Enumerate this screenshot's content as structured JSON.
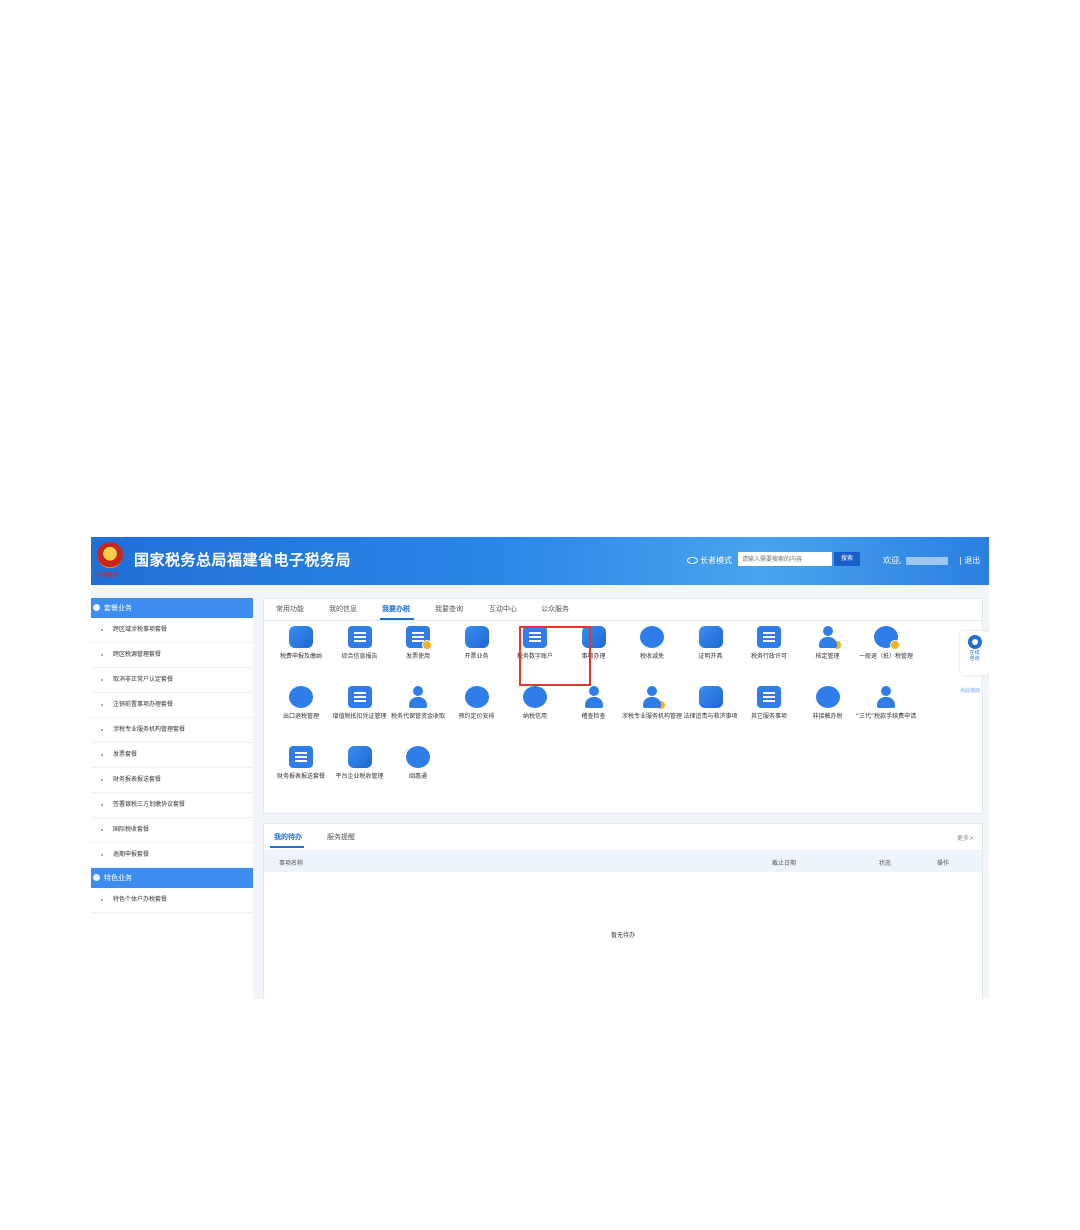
{
  "header": {
    "emblem_text": "中国税务",
    "title": "国家税务总局福建省电子税务局",
    "elder_mode": "长者模式",
    "search_placeholder": "请输入需要搜索的内容",
    "search_button": "搜索",
    "welcome": "欢迎,",
    "logout": "| 退出"
  },
  "sidebar": {
    "group1": "套餐业务",
    "items1": [
      "跨区域涉税事项套餐",
      "跨区税源管理套餐",
      "取消非正常户认定套餐",
      "注销前置事项办理套餐",
      "涉税专业服务机构管理套餐",
      "发票套餐",
      "财务报表报送套餐",
      "签署银税三方划缴协议套餐",
      "国际税收套餐",
      "逾期申报套餐"
    ],
    "group2": "特色业务",
    "items2": [
      "特色个体户办税套餐"
    ]
  },
  "tabs": [
    "常用功能",
    "我的信息",
    "我要办税",
    "我要查询",
    "互动中心",
    "公众服务"
  ],
  "services": [
    {
      "label": "税费申报及缴纳",
      "icon": "tax-declare-icon"
    },
    {
      "label": "综合信息报告",
      "icon": "report-doc-icon"
    },
    {
      "label": "发票使用",
      "icon": "invoice-icon"
    },
    {
      "label": "开票业务",
      "icon": "issue-invoice-icon"
    },
    {
      "label": "税务数字账户",
      "icon": "digital-account-icon"
    },
    {
      "label": "事项办理",
      "icon": "edit-matter-icon"
    },
    {
      "label": "税收减免",
      "icon": "tax-relief-icon"
    },
    {
      "label": "证明开具",
      "icon": "certificate-icon"
    },
    {
      "label": "税务行政许可",
      "icon": "license-icon"
    },
    {
      "label": "核定管理",
      "icon": "assessment-icon"
    },
    {
      "label": "一般退（抵）税管理",
      "icon": "refund-icon"
    },
    {
      "label": "出口退税管理",
      "icon": "export-refund-icon"
    },
    {
      "label": "增值税抵扣凭证管理",
      "icon": "vat-voucher-icon"
    },
    {
      "label": "税务代保管资金收取",
      "icon": "custody-funds-icon"
    },
    {
      "label": "预约定价安排",
      "icon": "pricing-icon"
    },
    {
      "label": "纳税信用",
      "icon": "credit-icon"
    },
    {
      "label": "稽查检查",
      "icon": "inspection-icon"
    },
    {
      "label": "涉税专业服务机构管理",
      "icon": "agency-icon"
    },
    {
      "label": "法律追责与救济事项",
      "icon": "gavel-icon"
    },
    {
      "label": "其它服务事项",
      "icon": "other-service-icon"
    },
    {
      "label": "非接触办税",
      "icon": "globe-icon"
    },
    {
      "label": "“三代”税款手续费申请",
      "icon": "money-bag-icon"
    },
    {
      "label": "财务报表报送套餐",
      "icon": "finance-report-icon"
    },
    {
      "label": "平台企业税收管理",
      "icon": "platform-icon"
    },
    {
      "label": "闽惠通",
      "icon": "bulb-icon"
    }
  ],
  "todo": {
    "tab_mine": "我的待办",
    "tab_remind": "服务提醒",
    "more": "更多>",
    "col_name": "事项名称",
    "col_deadline": "截止日期",
    "col_status": "状态",
    "col_action": "操作",
    "empty": "暂无待办"
  },
  "float": {
    "line1": "在线",
    "line2": "咨询",
    "drag": "点此拖动"
  },
  "colors": {
    "primary": "#1f6fd8",
    "highlight": "#e03a2e",
    "sidebar_head": "#3d8df0",
    "accent_gold": "#f5b21b"
  }
}
